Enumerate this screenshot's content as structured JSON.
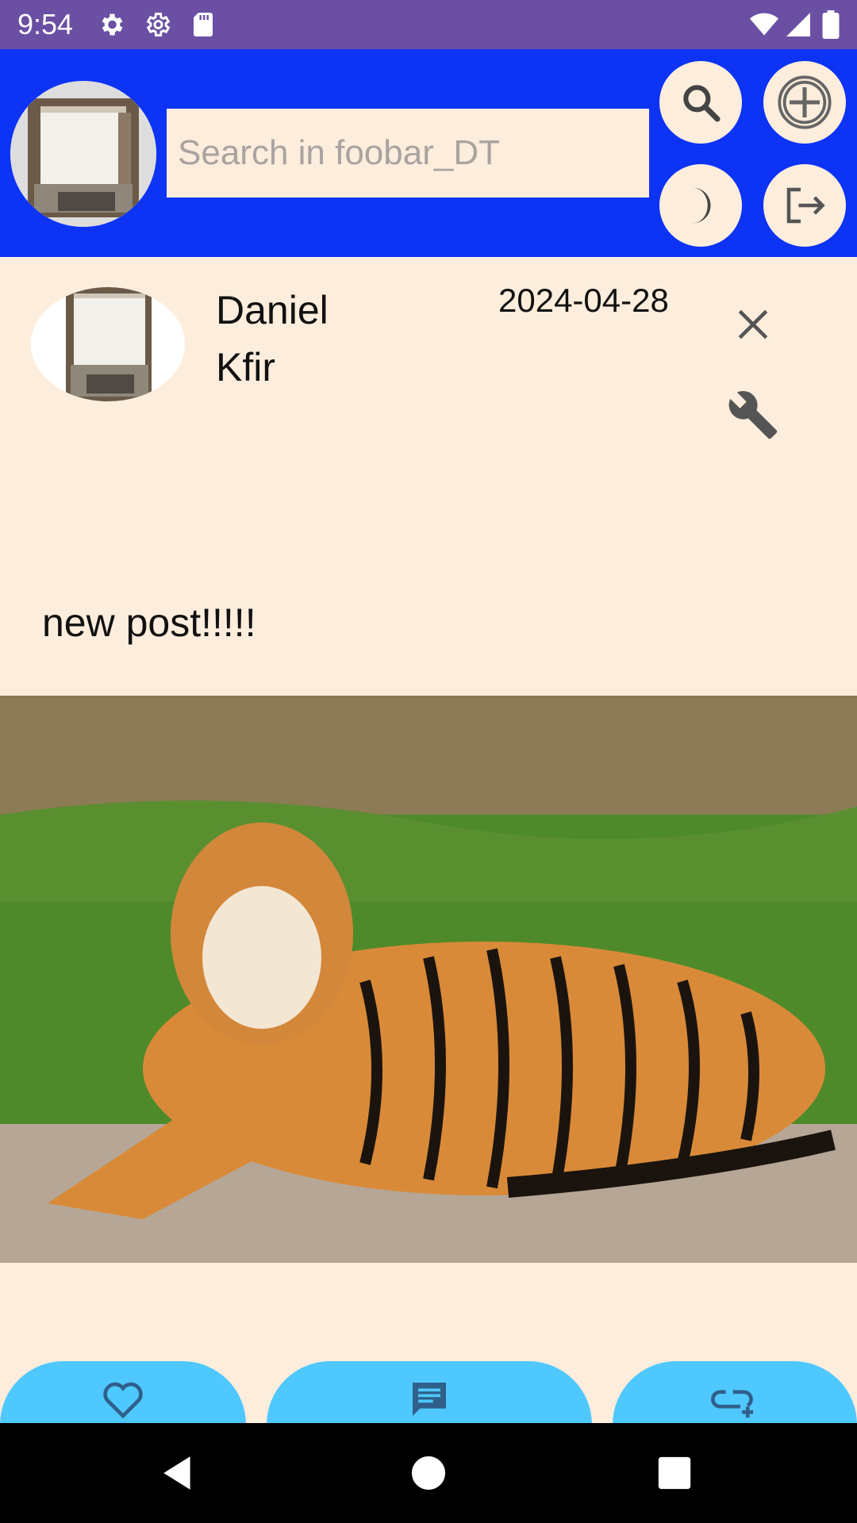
{
  "status_bar": {
    "time": "9:54",
    "icons": [
      "settings-icon",
      "settings-outline-icon",
      "sd-card-icon",
      "wifi-icon",
      "signal-icon",
      "battery-icon"
    ]
  },
  "header": {
    "search": {
      "placeholder": "Search in foobar_DT",
      "value": ""
    },
    "buttons": [
      "search-icon",
      "add-circle-icon",
      "dark-mode-icon",
      "logout-icon"
    ]
  },
  "post": {
    "author": "Daniel Kfir",
    "date": "2024-04-28",
    "text": "new post!!!!!",
    "actions": [
      "close-icon",
      "wrench-icon"
    ]
  },
  "action_bar": [
    "like-heart-icon",
    "comment-icon",
    "share-icon"
  ],
  "nav_bar": [
    "back-icon",
    "home-icon",
    "recents-icon"
  ],
  "colors": {
    "status_bar": "#6a4fa3",
    "header": "#0d33f5",
    "background": "#fdeddc",
    "action_button": "#4fc8ff"
  }
}
